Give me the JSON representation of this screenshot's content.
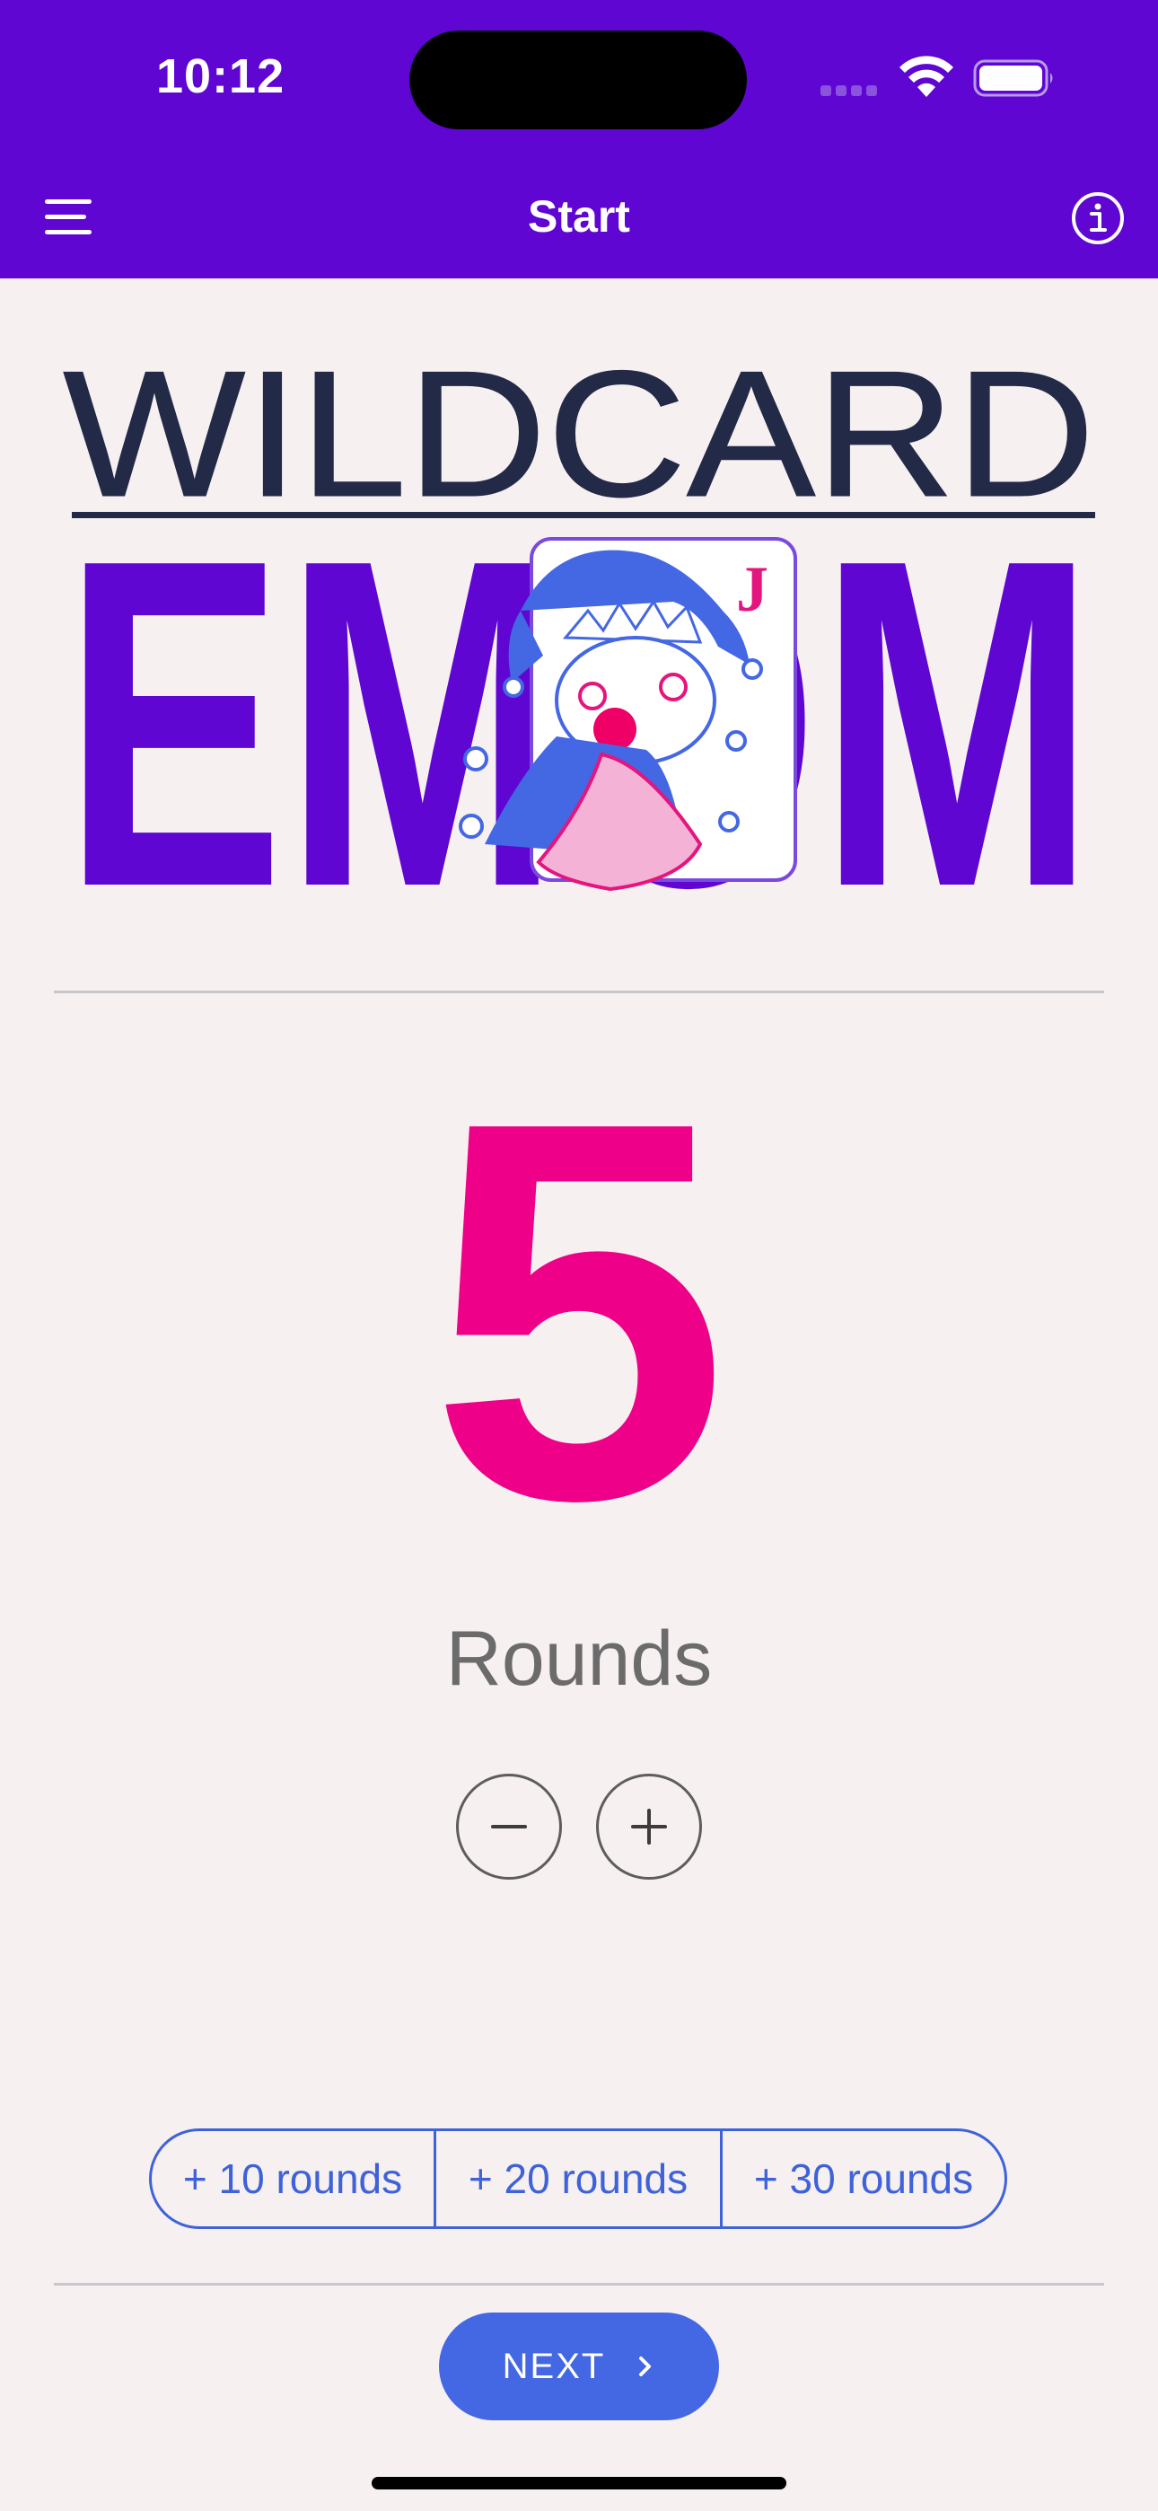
{
  "status_bar": {
    "time": "10:12"
  },
  "nav": {
    "title": "Start",
    "menu_icon": "hamburger-menu-icon",
    "info_icon": "info-circle-icon"
  },
  "logo": {
    "line1": "WILDCARD",
    "line2": "EMOM",
    "card_letter": "J"
  },
  "counter": {
    "value": "5",
    "label": "Rounds",
    "decrement_symbol": "−",
    "increment_symbol": "+"
  },
  "quick_add": [
    {
      "label": "+ 10 rounds"
    },
    {
      "label": "+ 20 rounds"
    },
    {
      "label": "+ 30 rounds"
    }
  ],
  "footer": {
    "next_label": "NEXT"
  },
  "colors": {
    "brand_purple": "#5F06D2",
    "accent_pink": "#EE0088",
    "button_blue": "#4467E3",
    "background": "#F7F0F1"
  }
}
